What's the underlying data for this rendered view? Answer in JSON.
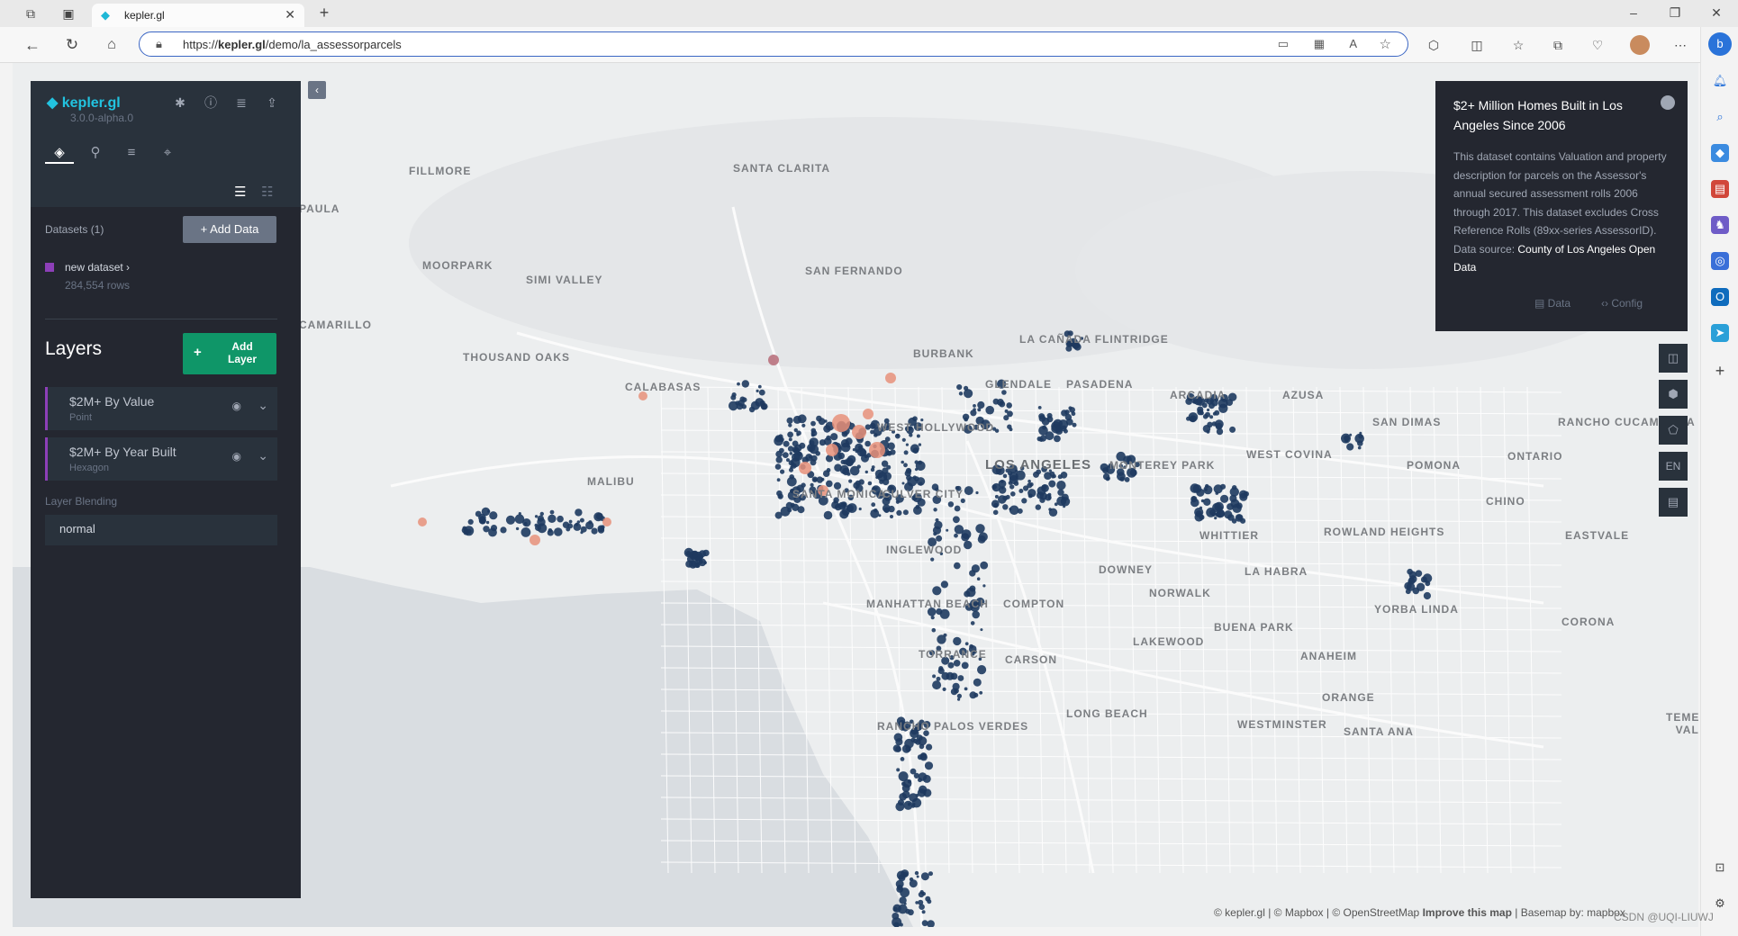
{
  "browser": {
    "tab_title": "kepler.gl",
    "new_tab_icon": "plus-icon",
    "url_prefix": "https://",
    "url_domain": "kepler.gl",
    "url_path": "/demo/la_assessorparcels"
  },
  "kepler": {
    "logo_text": "kepler.gl",
    "version": "3.0.0-alpha.0",
    "datasets_label": "Datasets (1)",
    "add_data_label": "+  Add Data",
    "dataset_name": "new dataset",
    "dataset_rows": "284,554 rows",
    "dataset_color": "#8d3fb8",
    "layers_title": "Layers",
    "add_layer_plus": "+",
    "add_layer_label": "Add Layer",
    "layers": [
      {
        "name": "$2M+ By Value",
        "type": "Point"
      },
      {
        "name": "$2M+ By Year Built",
        "type": "Hexagon"
      }
    ],
    "layer_blending_label": "Layer Blending",
    "layer_blending_value": "normal"
  },
  "infocard": {
    "title": "$2+ Million Homes Built in Los Angeles Since 2006",
    "description": "This dataset contains Valuation and property description for parcels on the Assessor's annual secured assessment rolls 2006 through 2017. This dataset excludes Cross Reference Rolls (89xx-series AssessorID). Data source:",
    "source_link": "County of Los Angeles Open Data",
    "data_button": "Data",
    "config_button": "Config"
  },
  "map_controls": {
    "locale": "EN"
  },
  "places": [
    "FILLMORE",
    "SANTA CLARITA",
    "PAULA",
    "MOORPARK",
    "SIMI VALLEY",
    "SAN FERNANDO",
    "CAMARILLO",
    "THOUSAND OAKS",
    "CALABASAS",
    "BURBANK",
    "LA CAÑADA FLINTRIDGE",
    "GLENDALE",
    "PASADENA",
    "ARCADIA",
    "AZUSA",
    "SAN DIMAS",
    "RANCHO CUCAMONGA",
    "WEST HOLLYWOOD",
    "LOS ANGELES",
    "MONTEREY PARK",
    "WEST COVINA",
    "POMONA",
    "ONTARIO",
    "MALIBU",
    "SANTA MONICA",
    "CULVER CITY",
    "CHINO",
    "INGLEWOOD",
    "WHITTIER",
    "ROWLAND HEIGHTS",
    "EASTVALE",
    "DOWNEY",
    "LA HABRA",
    "NORWALK",
    "MANHATTAN BEACH",
    "COMPTON",
    "YORBA LINDA",
    "BUENA PARK",
    "CORONA",
    "LAKEWOOD",
    "TORRANCE",
    "CARSON",
    "ANAHEIM",
    "ORANGE",
    "LONG BEACH",
    "RANCHO PALOS VERDES",
    "WESTMINSTER",
    "SANTA ANA",
    "TEMESCAL VALLEY"
  ],
  "attribution": {
    "kepler": "© kepler.gl",
    "mapbox": "© Mapbox",
    "osm": "© OpenStreetMap",
    "improve": "Improve this map",
    "basemap": "Basemap by:",
    "mapbox_logo": "mapbox"
  },
  "watermark": "CSDN @UQI-LIUWJ"
}
